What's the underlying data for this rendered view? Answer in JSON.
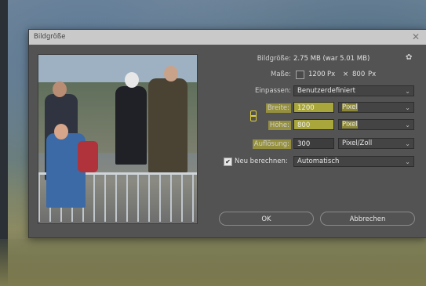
{
  "dialog": {
    "title": "Bildgröße",
    "close_glyph": "✕",
    "image_size": {
      "label": "Bildgröße:",
      "value": "2.75 MB (war 5.01 MB)"
    },
    "dimensions": {
      "label": "Maße:",
      "width_value": "1200",
      "unit_left": "Px",
      "times": "×",
      "height_value": "800",
      "unit_right": "Px"
    },
    "fit": {
      "label": "Einpassen:",
      "selected": "Benutzerdefiniert"
    },
    "width": {
      "label": "Breite:",
      "value": "1200",
      "unit": "Pixel"
    },
    "height": {
      "label": "Höhe:",
      "value": "800",
      "unit": "Pixel"
    },
    "resolution": {
      "label": "Auflösung:",
      "value": "300",
      "unit": "Pixel/Zoll"
    },
    "resample": {
      "label": "Neu berechnen:",
      "checked": true,
      "check_glyph": "✔",
      "selected": "Automatisch"
    },
    "buttons": {
      "ok": "OK",
      "cancel": "Abbrechen"
    },
    "icons": {
      "gear": "gear-icon",
      "chevron": "chevron-down-icon",
      "link": "chain-link-icon"
    }
  },
  "colors": {
    "highlight": "#e6dc28",
    "dialog_bg": "#535353",
    "titlebar_bg": "#c9c9c9"
  }
}
